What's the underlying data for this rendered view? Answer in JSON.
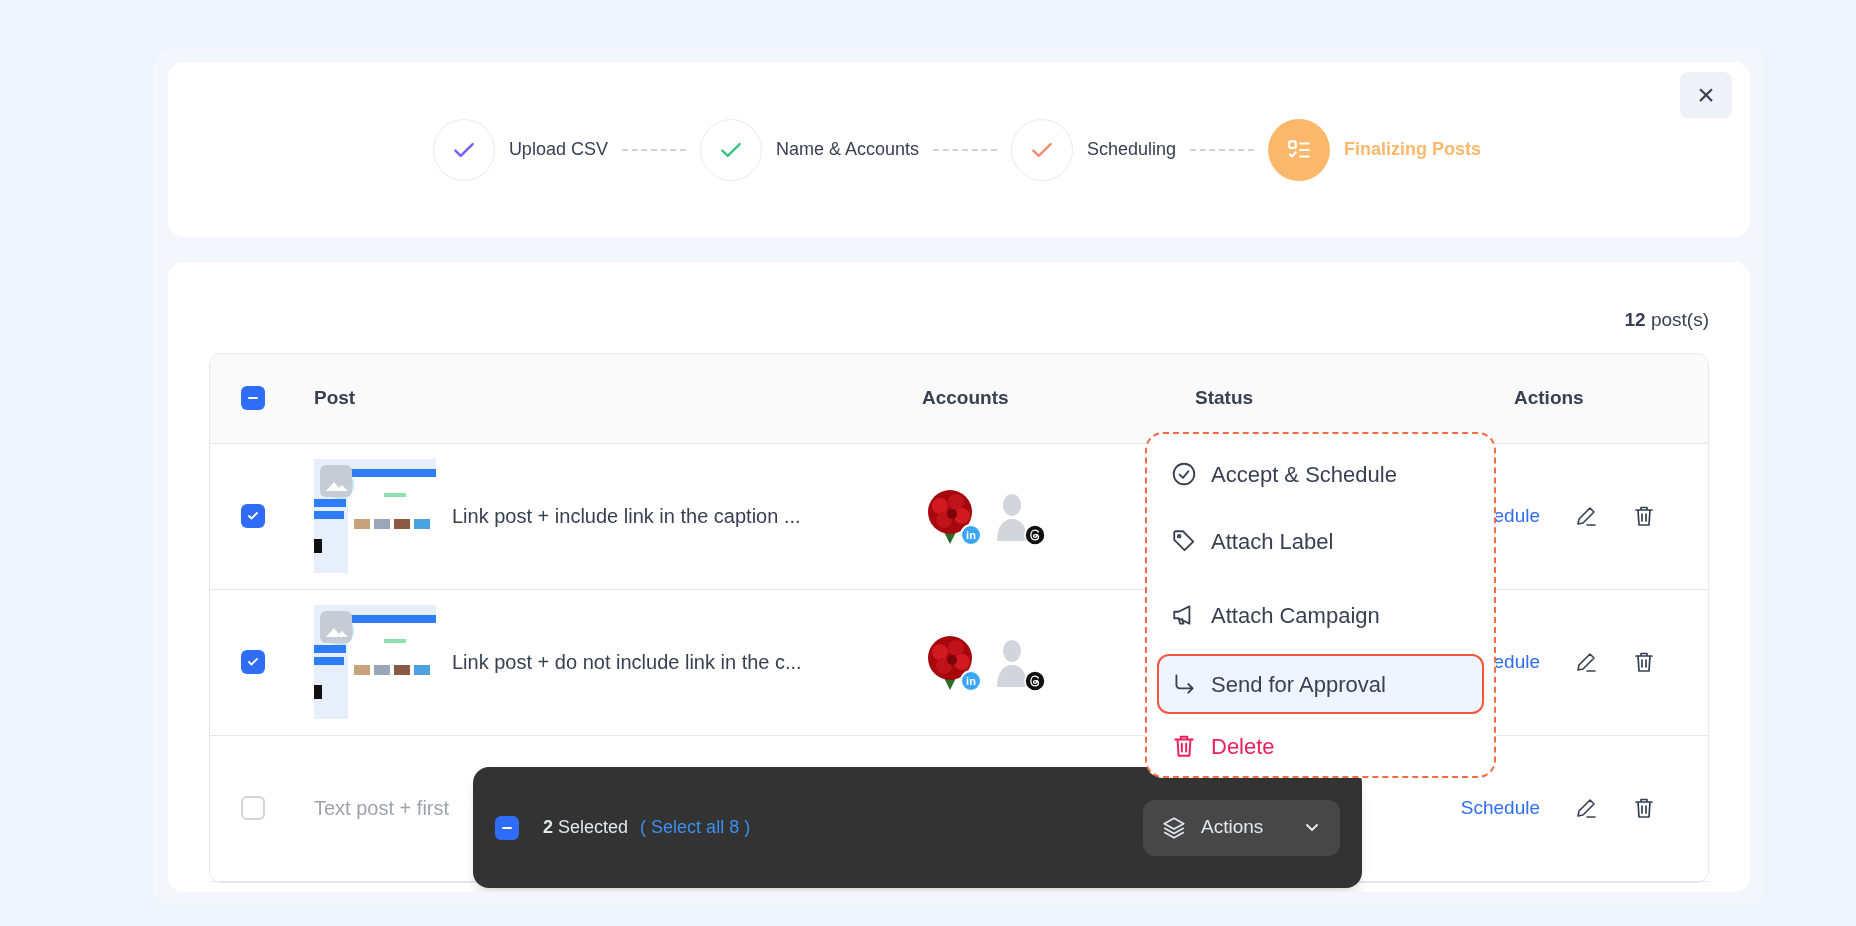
{
  "close_button": {
    "label": "×"
  },
  "steps": [
    {
      "label": "Upload CSV",
      "color": "#6c63ff",
      "selected": false
    },
    {
      "label": "Name & Accounts",
      "color": "#34c77b",
      "selected": false
    },
    {
      "label": "Scheduling",
      "color": "#f98a6c",
      "selected": false
    },
    {
      "label": "Finalizing Posts",
      "color": "#fbb86b",
      "selected": true
    }
  ],
  "post_count": {
    "number": "12",
    "label": "post(s)"
  },
  "table": {
    "header_checkbox": {
      "indeterminate": true
    },
    "columns": [
      "Post",
      "Accounts",
      "Status",
      "Actions"
    ],
    "rows": [
      {
        "checked": true,
        "kind": "link",
        "text": "Link post + include link in the caption ...",
        "accounts": [
          {
            "badge": {
              "kind": "linkedin",
              "label": "in"
            }
          },
          {
            "kind": "silhouette",
            "badge": {
              "kind": "threads"
            }
          }
        ],
        "action": "edule"
      },
      {
        "checked": true,
        "kind": "link",
        "text": "Link post + do not include link in the c...",
        "accounts": [
          {
            "badge": {
              "kind": "linkedin",
              "label": "in"
            }
          },
          {
            "kind": "silhouette",
            "badge": {
              "kind": "threads"
            }
          }
        ],
        "action": "edule"
      },
      {
        "checked": false,
        "kind": "text",
        "text": "Text post + first",
        "action": "Schedule"
      }
    ]
  },
  "menu": [
    {
      "label": "Accept & Schedule",
      "kind": "action",
      "selected": false
    },
    {
      "label": "Attach Label",
      "kind": "action",
      "selected": false
    },
    {
      "label": "Attach Campaign",
      "kind": "action",
      "selected": false
    },
    {
      "label": "Send for Approval",
      "kind": "action",
      "selected": true
    },
    {
      "label": "Delete",
      "kind": "danger",
      "selected": false
    }
  ],
  "selection_bar": {
    "indeterminate": true,
    "count": "2",
    "label": "Selected",
    "select_all": "( Select all 8 )",
    "actions_button": "Actions"
  }
}
